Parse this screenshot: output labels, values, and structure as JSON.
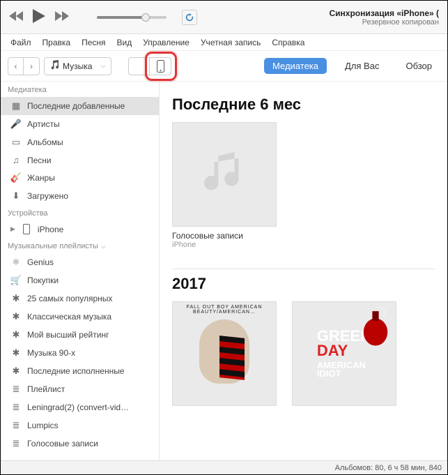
{
  "sync": {
    "line1": "Синхронизация «iPhone» (",
    "line2": "Резервное копирован"
  },
  "menus": [
    "Файл",
    "Правка",
    "Песня",
    "Вид",
    "Управление",
    "Учетная запись",
    "Справка"
  ],
  "library_chip": "Музыка",
  "tabs": {
    "mediateka": "Медиатека",
    "dlya_vas": "Для Вас",
    "obzor": "Обзор"
  },
  "sidebar": {
    "mediateka_head": "Медиатека",
    "items": [
      "Последние добавленные",
      "Артисты",
      "Альбомы",
      "Песни",
      "Жанры",
      "Загружено"
    ],
    "devices_head": "Устройства",
    "device": "iPhone",
    "playlists_head": "Музыкальные плейлисты",
    "playlists": [
      "Genius",
      "Покупки",
      "25 самых популярных",
      "Классическая музыка",
      "Мой высший рейтинг",
      "Музыка 90-х",
      "Последние исполненные",
      "Плейлист",
      "Leningrad(2)  (convert-vid…",
      "Lumpics",
      "Голосовые записи"
    ]
  },
  "content": {
    "section1_title": "Последние 6 мес",
    "album1_name": "Голосовые записи",
    "album1_sub": "iPhone",
    "section2_title": "2017",
    "fob_top": "FALL OUT BOY     AMERICAN BEAUTY/AMERICAN…",
    "gd_line1": "GREEN",
    "gd_line2": "DAY",
    "gd_line3": "AMERICAN",
    "gd_line4": "IDIOT"
  },
  "status": "Альбомов: 80, 6 ч 58 мин, 840"
}
